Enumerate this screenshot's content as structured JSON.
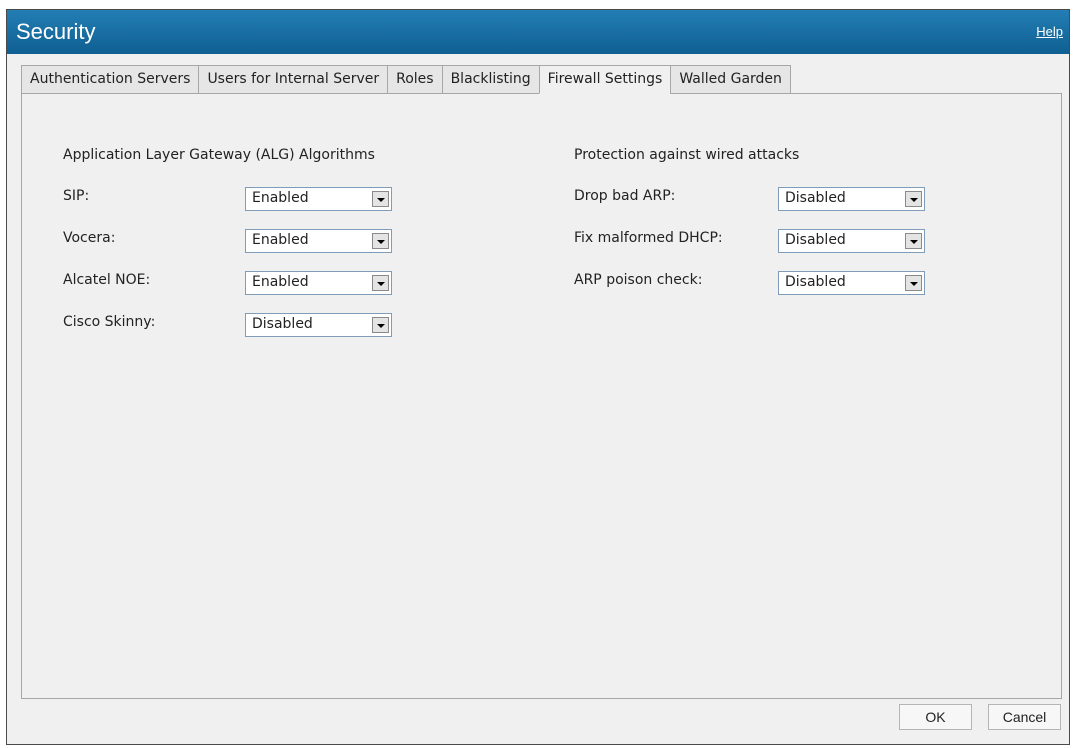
{
  "window": {
    "title": "Security",
    "help": "Help"
  },
  "tabs": [
    {
      "label": "Authentication Servers",
      "active": false
    },
    {
      "label": "Users for Internal Server",
      "active": false
    },
    {
      "label": "Roles",
      "active": false
    },
    {
      "label": "Blacklisting",
      "active": false
    },
    {
      "label": "Firewall Settings",
      "active": true
    },
    {
      "label": "Walled Garden",
      "active": false
    }
  ],
  "alg": {
    "title": "Application Layer Gateway (ALG) Algorithms",
    "fields": [
      {
        "label": "SIP:",
        "value": "Enabled"
      },
      {
        "label": "Vocera:",
        "value": "Enabled"
      },
      {
        "label": "Alcatel NOE:",
        "value": "Enabled"
      },
      {
        "label": "Cisco Skinny:",
        "value": "Disabled"
      }
    ]
  },
  "wired": {
    "title": "Protection against wired attacks",
    "fields": [
      {
        "label": "Drop bad ARP:",
        "value": "Disabled"
      },
      {
        "label": "Fix malformed DHCP:",
        "value": "Disabled"
      },
      {
        "label": "ARP poison check:",
        "value": "Disabled"
      }
    ]
  },
  "buttons": {
    "ok": "OK",
    "cancel": "Cancel"
  }
}
